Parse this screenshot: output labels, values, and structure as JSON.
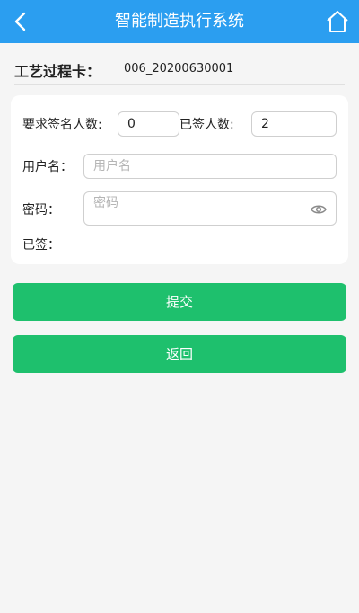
{
  "header": {
    "title": "智能制造执行系统",
    "back_icon": "chevron-left",
    "home_icon": "house"
  },
  "process_card": {
    "label": "工艺过程卡：",
    "value": "006_20200630001"
  },
  "form": {
    "required_signers_label": "要求签名人数:",
    "required_signers_value": "0",
    "signed_count_label": "已签人数:",
    "signed_count_value": "2",
    "username_label": "用户名：",
    "username_placeholder": "用户名",
    "username_value": "",
    "password_label": "密码：",
    "password_placeholder": "密码",
    "password_value": "",
    "signed_label": "已签："
  },
  "buttons": {
    "submit_label": "提交",
    "back_label": "返回"
  },
  "colors": {
    "header_bg": "#2b9ef0",
    "button_bg": "#1ec06d",
    "page_bg": "#f5f5f5"
  }
}
